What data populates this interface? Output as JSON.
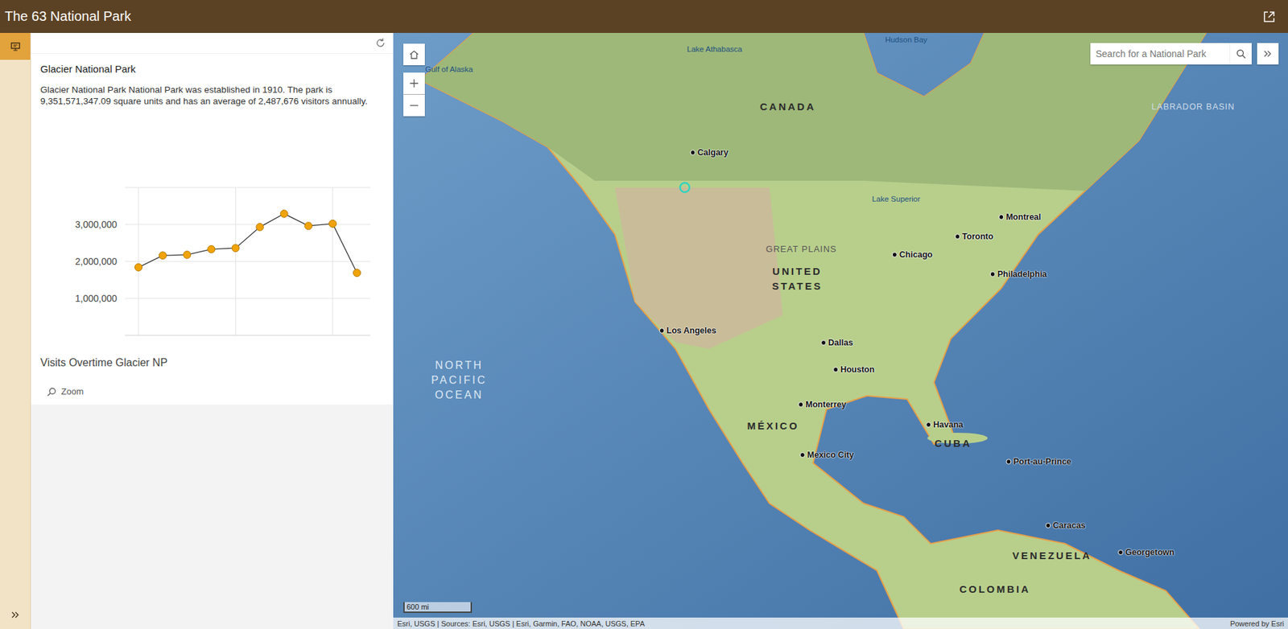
{
  "header": {
    "title": "The 63 National Park"
  },
  "panel": {
    "title": "Glacier National Park",
    "description": "Glacier National Park National Park was established in 1910. The park is 9,351,571,347.09 square units and has an average of 2,487,676 visitors annually.",
    "chart": {
      "title": "Visits Overtime Glacier NP",
      "y_ticks": [
        {
          "label": "3,000,000",
          "value": 3000000
        },
        {
          "label": "2,000,000",
          "value": 2000000
        },
        {
          "label": "1,000,000",
          "value": 1000000
        }
      ],
      "y_max": 4000000,
      "values": [
        1840000,
        2160000,
        2180000,
        2330000,
        2360000,
        2930000,
        3290000,
        2960000,
        3020000,
        1690000
      ]
    },
    "zoom": "Zoom"
  },
  "map": {
    "search": {
      "placeholder": "Search for a National Park"
    },
    "scale": "600 mi",
    "attribution": "Esri, USGS | Sources: Esri, USGS | Esri, Garmin, FAO, NOAA, USGS, EPA",
    "powered_by": "Powered by Esri",
    "labels": [
      {
        "text": "CANADA",
        "kind": "country"
      },
      {
        "text": "UNITED STATES",
        "kind": "country"
      },
      {
        "text": "MÉXICO",
        "kind": "country"
      },
      {
        "text": "VENEZUELA",
        "kind": "country"
      },
      {
        "text": "COLOMBIA",
        "kind": "country"
      },
      {
        "text": "CUBA",
        "kind": "country"
      },
      {
        "text": "Calgary",
        "kind": "city"
      },
      {
        "text": "Chicago",
        "kind": "city"
      },
      {
        "text": "Toronto",
        "kind": "city"
      },
      {
        "text": "Montreal",
        "kind": "city"
      },
      {
        "text": "Philadelphia",
        "kind": "city"
      },
      {
        "text": "Los Angeles",
        "kind": "city"
      },
      {
        "text": "Dallas",
        "kind": "city"
      },
      {
        "text": "Houston",
        "kind": "city"
      },
      {
        "text": "Monterrey",
        "kind": "city"
      },
      {
        "text": "Mexico City",
        "kind": "city"
      },
      {
        "text": "Havana",
        "kind": "city"
      },
      {
        "text": "Port-au-Prince",
        "kind": "city"
      },
      {
        "text": "Caracas",
        "kind": "city"
      },
      {
        "text": "Georgetown",
        "kind": "city"
      },
      {
        "text": "NORTH PACIFIC OCEAN",
        "kind": "ocean"
      },
      {
        "text": "GREAT PLAINS",
        "kind": "region"
      },
      {
        "text": "Hudson Bay",
        "kind": "water"
      },
      {
        "text": "Lake Athabasca",
        "kind": "water"
      },
      {
        "text": "Lake Superior",
        "kind": "water"
      },
      {
        "text": "Gulf of Alaska",
        "kind": "water"
      },
      {
        "text": "LABRADOR BASIN",
        "kind": "sea"
      }
    ]
  }
}
